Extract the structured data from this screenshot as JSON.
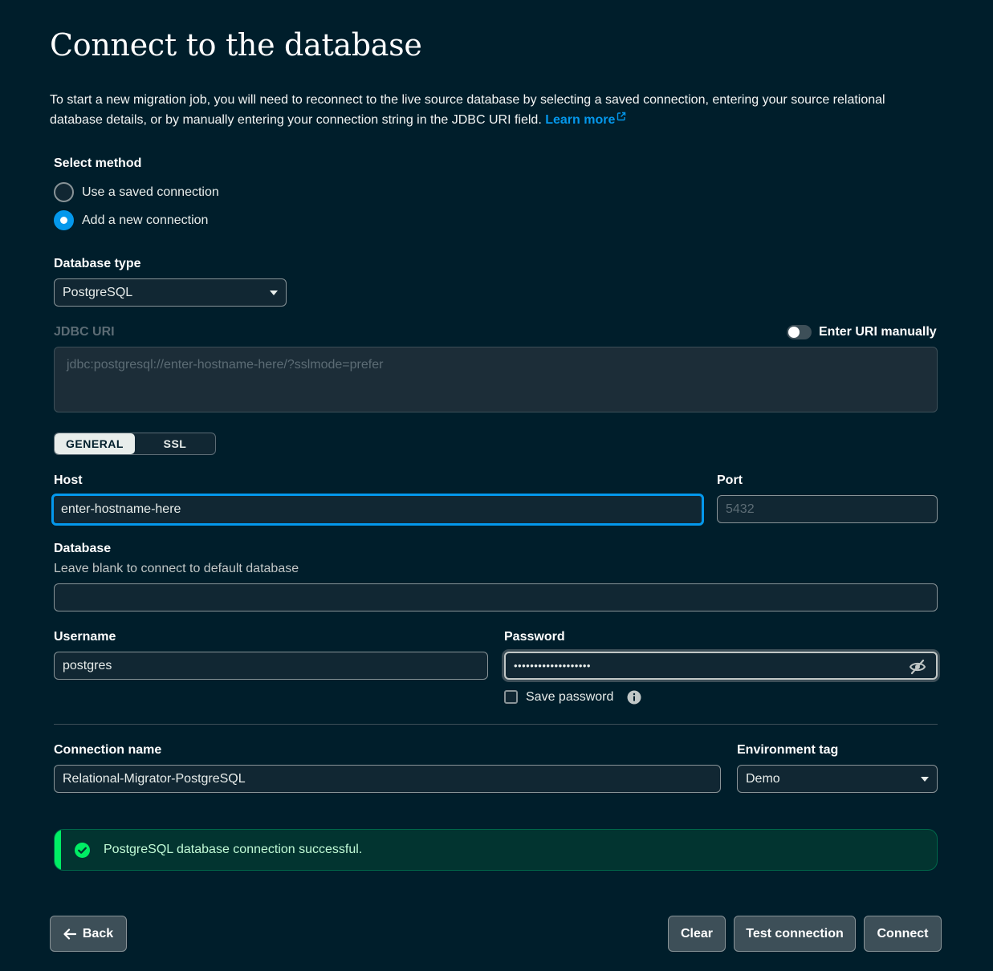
{
  "page": {
    "title": "Connect to the database",
    "intro": "To start a new migration job, you will need to reconnect to the live source database by selecting a saved connection, entering your source relational database details, or by manually entering your connection string in the JDBC URI field.",
    "learn_more": "Learn more"
  },
  "method": {
    "label": "Select method",
    "options": [
      {
        "label": "Use a saved connection",
        "selected": false
      },
      {
        "label": "Add a new connection",
        "selected": true
      }
    ]
  },
  "database_type": {
    "label": "Database type",
    "value": "PostgreSQL"
  },
  "jdbc": {
    "label": "JDBC URI",
    "placeholder": "jdbc:postgresql://enter-hostname-here/?sslmode=prefer",
    "toggle_label": "Enter URI manually",
    "toggle_on": false
  },
  "tabs": [
    {
      "label": "GENERAL",
      "active": true
    },
    {
      "label": "SSL",
      "active": false
    }
  ],
  "host": {
    "label": "Host",
    "value": "enter-hostname-here"
  },
  "port": {
    "label": "Port",
    "placeholder": "5432"
  },
  "database": {
    "label": "Database",
    "description": "Leave blank to connect to default database",
    "value": ""
  },
  "username": {
    "label": "Username",
    "value": "postgres"
  },
  "password": {
    "label": "Password",
    "value": "•••••••••••••••••••",
    "save_label": "Save password",
    "save_checked": false
  },
  "connection_name": {
    "label": "Connection name",
    "value": "Relational-Migrator-PostgreSQL"
  },
  "environment_tag": {
    "label": "Environment tag",
    "value": "Demo"
  },
  "banner": {
    "text": "PostgreSQL database connection successful.",
    "color": "#00ed64"
  },
  "buttons": {
    "back": "Back",
    "clear": "Clear",
    "test": "Test connection",
    "connect": "Connect"
  },
  "colors": {
    "background": "#001e2b",
    "accent": "#0498ec",
    "success": "#00ed64"
  }
}
